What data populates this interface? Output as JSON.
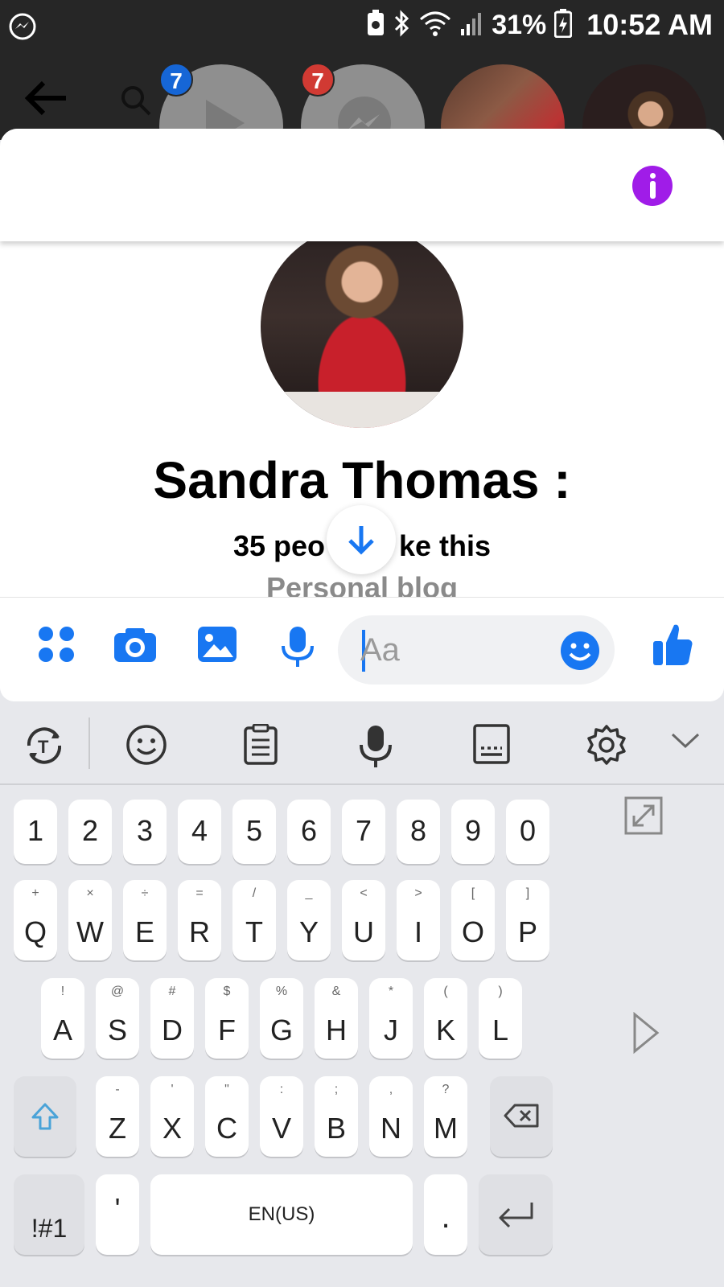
{
  "status_bar": {
    "battery_percent": "31%",
    "time": "10:52 AM",
    "icons": [
      "messenger-icon",
      "battery-saver-icon",
      "bluetooth-icon",
      "wifi-icon",
      "signal-icon",
      "battery-icon"
    ]
  },
  "chat_heads": {
    "badges": [
      "7",
      "7"
    ],
    "icons": [
      "back-arrow-icon",
      "search-icon",
      "play-icon",
      "messenger-icon"
    ]
  },
  "profile": {
    "name": "Sandra Thomas :",
    "likes": "35 people like this",
    "likes_visible": "35 peo",
    "likes_visible_end": "ke this",
    "category": "Personal blog"
  },
  "composer": {
    "placeholder": "Aa",
    "icons": [
      "menu-grid-icon",
      "camera-icon",
      "gallery-icon",
      "microphone-icon",
      "emoji-icon",
      "thumbs-up-icon"
    ]
  },
  "accent_color": "#1877f2",
  "info_color": "#a01ce8",
  "keyboard": {
    "toolbar_icons": [
      "translate-icon",
      "emoji-icon",
      "clipboard-icon",
      "voice-input-icon",
      "keyboard-layout-icon",
      "settings-icon",
      "collapse-icon"
    ],
    "number_row": [
      "1",
      "2",
      "3",
      "4",
      "5",
      "6",
      "7",
      "8",
      "9",
      "0"
    ],
    "row1": [
      {
        "key": "Q",
        "sub": "+"
      },
      {
        "key": "W",
        "sub": "×"
      },
      {
        "key": "E",
        "sub": "÷"
      },
      {
        "key": "R",
        "sub": "="
      },
      {
        "key": "T",
        "sub": "/"
      },
      {
        "key": "Y",
        "sub": "_"
      },
      {
        "key": "U",
        "sub": "<"
      },
      {
        "key": "I",
        "sub": ">"
      },
      {
        "key": "O",
        "sub": "["
      },
      {
        "key": "P",
        "sub": "]"
      }
    ],
    "row2": [
      {
        "key": "A",
        "sub": "!"
      },
      {
        "key": "S",
        "sub": "@"
      },
      {
        "key": "D",
        "sub": "#"
      },
      {
        "key": "F",
        "sub": "$"
      },
      {
        "key": "G",
        "sub": "%"
      },
      {
        "key": "H",
        "sub": "&"
      },
      {
        "key": "J",
        "sub": "*"
      },
      {
        "key": "K",
        "sub": "("
      },
      {
        "key": "L",
        "sub": ")"
      }
    ],
    "row3": [
      {
        "key": "Z",
        "sub": "-"
      },
      {
        "key": "X",
        "sub": "'"
      },
      {
        "key": "C",
        "sub": "\""
      },
      {
        "key": "V",
        "sub": ":"
      },
      {
        "key": "B",
        "sub": ";"
      },
      {
        "key": "N",
        "sub": ","
      },
      {
        "key": "M",
        "sub": "?"
      }
    ],
    "symbols_label": "!#1",
    "apostrophe_label": "'",
    "space_label": "EN(US)",
    "period_label": "."
  }
}
